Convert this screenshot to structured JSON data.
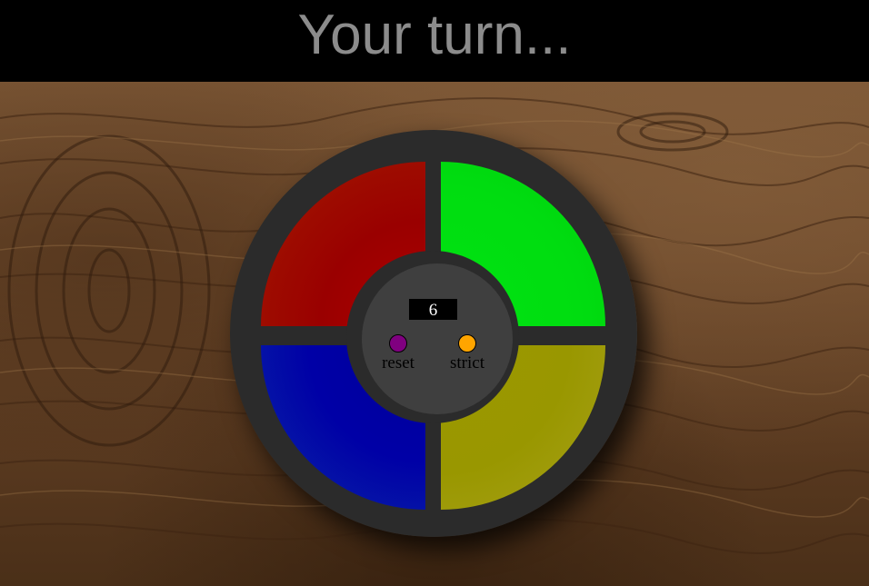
{
  "header": {
    "status_text": "Your turn..."
  },
  "game": {
    "count_display": "6",
    "pads": [
      {
        "color_name": "red",
        "color": "#9a0000"
      },
      {
        "color_name": "green",
        "color": "#00dd10"
      },
      {
        "color_name": "blue",
        "color": "#0000a6"
      },
      {
        "color_name": "yellow",
        "color": "#999700"
      }
    ],
    "controls": {
      "reset_label": "reset",
      "reset_color": "#800080",
      "strict_label": "strict",
      "strict_color": "#ffa500"
    }
  },
  "theme": {
    "header_background": "#000000",
    "header_text_color": "#8c8c8c",
    "console_color": "#2b2b2b",
    "hub_color": "#3f3f3f",
    "background_texture": "wood-grain"
  }
}
